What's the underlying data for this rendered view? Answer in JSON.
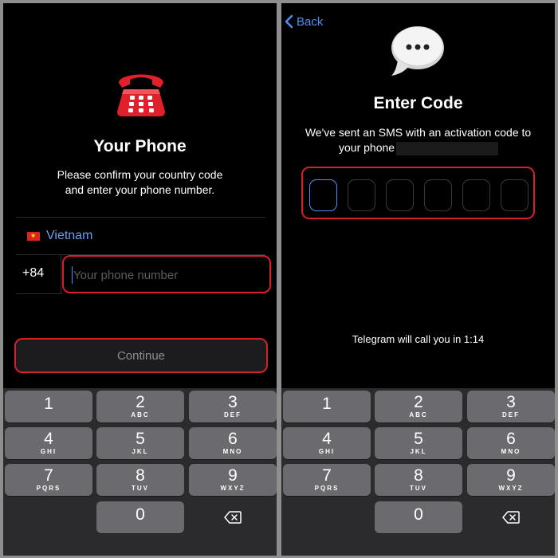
{
  "left": {
    "title": "Your Phone",
    "subtitle_line1": "Please confirm your country code",
    "subtitle_line2": "and enter your phone number.",
    "country": "Vietnam",
    "country_code": "+84",
    "phone_placeholder": "Your phone number",
    "continue_label": "Continue"
  },
  "right": {
    "back_label": "Back",
    "title": "Enter Code",
    "sms_line1": "We've sent an SMS with an activation code to",
    "sms_line2": "your phone",
    "call_text": "Telegram will call you in 1:14"
  },
  "keypad": {
    "keys": [
      {
        "digit": "1",
        "letters": ""
      },
      {
        "digit": "2",
        "letters": "ABC"
      },
      {
        "digit": "3",
        "letters": "DEF"
      },
      {
        "digit": "4",
        "letters": "GHI"
      },
      {
        "digit": "5",
        "letters": "JKL"
      },
      {
        "digit": "6",
        "letters": "MNO"
      },
      {
        "digit": "7",
        "letters": "PQRS"
      },
      {
        "digit": "8",
        "letters": "TUV"
      },
      {
        "digit": "9",
        "letters": "WXYZ"
      },
      {
        "digit": "0",
        "letters": ""
      }
    ]
  },
  "colors": {
    "accent_blue": "#4f8ef7",
    "highlight_red": "#d61f2b",
    "key_gray": "#6b6b6f",
    "keypad_bg": "#2b2b2d"
  },
  "icons": {
    "phone": "telephone-icon",
    "speech": "speech-bubble-icon",
    "back": "chevron-left-icon",
    "delete": "backspace-icon",
    "flag": "vietnam-flag-icon"
  }
}
